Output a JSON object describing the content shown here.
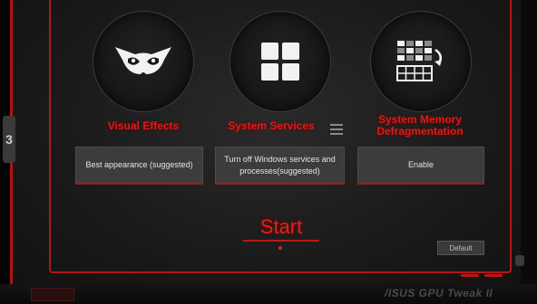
{
  "side_tab": {
    "label": "3"
  },
  "options": [
    {
      "title": "Visual Effects",
      "value": "Best appearance (suggested)",
      "icon": "owl-eyes-icon"
    },
    {
      "title": "System Services",
      "value": "Turn off Windows services and processes(suggested)",
      "icon": "grid-four-squares-icon"
    },
    {
      "title": "System Memory Defragmentation",
      "value": "Enable",
      "icon": "memory-defrag-icon"
    }
  ],
  "start_label": "Start",
  "default_label": "Default",
  "brand": {
    "text": "/ISUS  GPU Tweak II"
  },
  "colors": {
    "accent": "#e01a1a",
    "panel_border": "#b01818",
    "box_bg": "#3c3c3c",
    "background": "#1a1a1a"
  }
}
